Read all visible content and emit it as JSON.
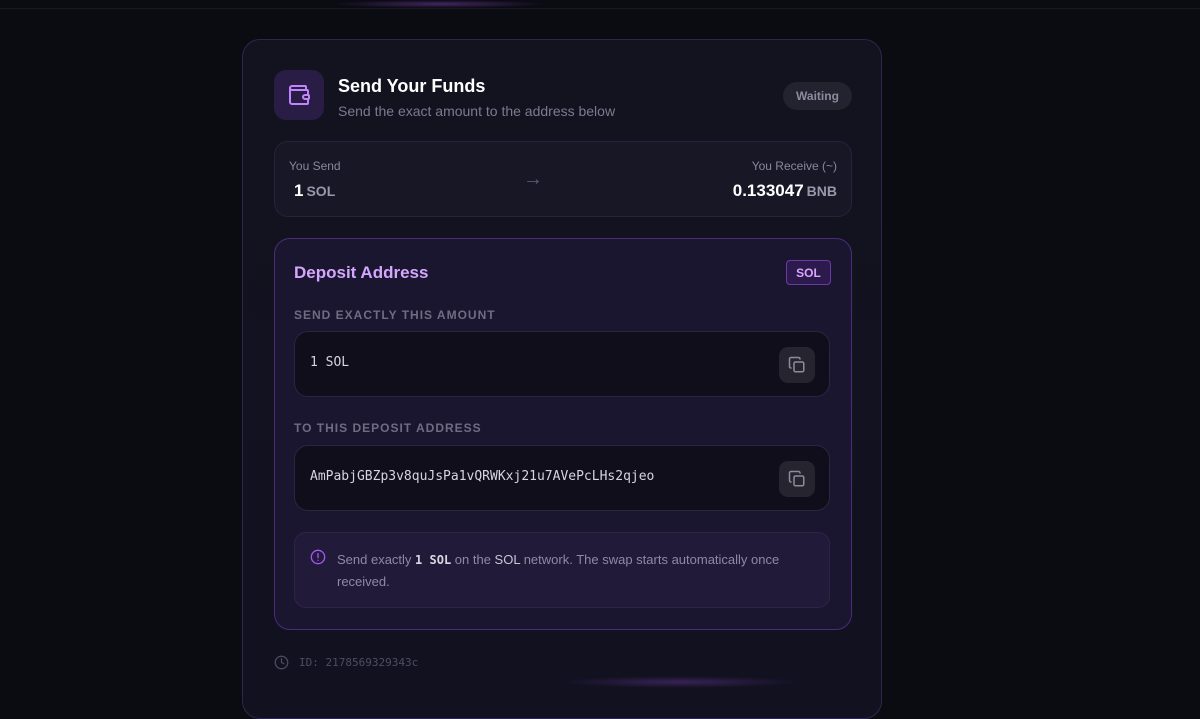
{
  "header": {
    "title": "Send Your Funds",
    "subtitle": "Send the exact amount to the address below",
    "status": "Waiting"
  },
  "summary": {
    "send_label": "You Send",
    "send_amount": "1",
    "send_unit": "SOL",
    "arrow": "→",
    "receive_label": "You Receive (~)",
    "receive_amount": "0.133047",
    "receive_unit": "BNB"
  },
  "deposit": {
    "title": "Deposit Address",
    "chain_badge": "SOL",
    "amount_label": "SEND EXACTLY THIS AMOUNT",
    "amount_value": "1 SOL",
    "address_label": "TO THIS DEPOSIT ADDRESS",
    "address_value": "AmPabjGBZp3v8quJsPa1vQRWKxj21u7AVePcLHs2qjeo",
    "notice": {
      "prefix": "Send exactly ",
      "amount": "1 SOL",
      "middle": " on the ",
      "network": "SOL",
      "suffix": " network. The swap starts automatically once received."
    }
  },
  "footer": {
    "id_text": "ID: 2178569329343c"
  },
  "icons": {
    "header": "wallet-icon",
    "copy": "copy-icon",
    "notice": "alert-circle-icon",
    "footer": "clock-icon"
  },
  "colors": {
    "accent": "#a855f7",
    "accent_text": "#d4a7ff",
    "background": "#0b0b12"
  }
}
